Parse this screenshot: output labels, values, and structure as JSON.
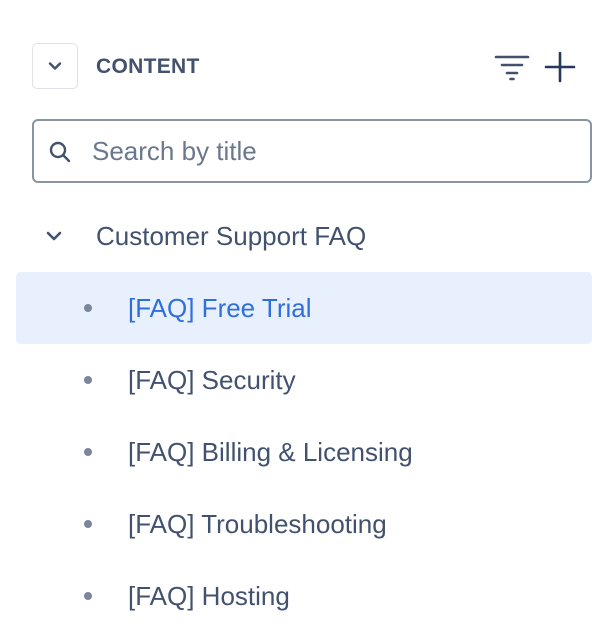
{
  "header": {
    "collapse_icon": "chevron-down-icon",
    "title": "CONTENT",
    "filter_icon": "filter-icon",
    "add_icon": "plus-icon"
  },
  "search": {
    "icon": "search-icon",
    "placeholder": "Search by title",
    "value": ""
  },
  "tree": {
    "parent": {
      "label": "Customer Support FAQ",
      "expanded": true,
      "icon": "chevron-down-icon"
    },
    "items": [
      {
        "label": "[FAQ] Free Trial",
        "selected": true
      },
      {
        "label": "[FAQ] Security",
        "selected": false
      },
      {
        "label": "[FAQ] Billing & Licensing",
        "selected": false
      },
      {
        "label": "[FAQ] Troubleshooting",
        "selected": false
      },
      {
        "label": "[FAQ] Hosting",
        "selected": false
      }
    ]
  },
  "colors": {
    "text": "#42526e",
    "selected_bg": "#e9f0fd",
    "selected_text": "#2f6fdc",
    "border": "#8993a4"
  }
}
